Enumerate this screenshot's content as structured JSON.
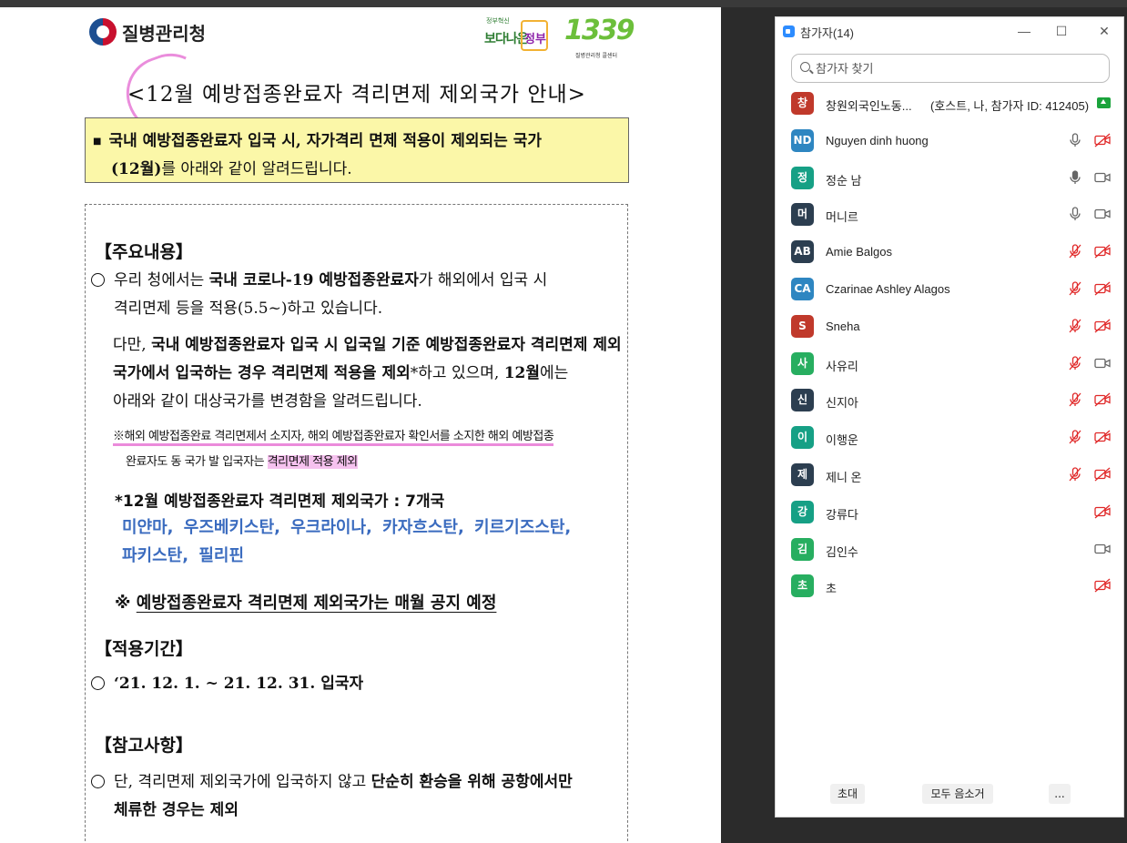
{
  "document": {
    "logo_text": "질병관리청",
    "gov_logo_small": "정부혁신",
    "gov_logo_big": "보다나은",
    "gov_logo_bracket": "정부",
    "hotline": "1339",
    "hotline_sub": "질병관리청 콜센터",
    "title": "<12월 예방접종완료자 격리면제 제외국가 안내>",
    "notice_line1": "국내 예방접종완료자 입국 시, 자가격리 면제 적용이 제외되는 국가",
    "notice_line2_bold": "(12월)",
    "notice_line2_rest": "를 아래와 같이 알려드립니다.",
    "main_heading": "【주요내용】",
    "p1_a": "우리 청에서는 ",
    "p1_b": "국내 코로나-19 예방접종완료자",
    "p1_c": "가 해외에서 입국 시",
    "p1_line2": "격리면제 등을 적용(5.5~)하고 있습니다.",
    "p2_a": "다만, ",
    "p2_b": "국내 예방접종완료자 입국 시 입국일 기준 예방접종완료자 격리면제 제외국가에서 입국하는 경우 격리면제 적용을 제외",
    "p2_c": "*하고 있으며, ",
    "p2_d": "12월",
    "p2_e": "에는",
    "p2_line3": "아래와 같이 대상국가를 변경함을 알려드립니다.",
    "note_a": "※해외 예방접종완료 격리면제서 소지자, 해외 예방접종완료자 확인서를 소지한 해외 예방접종",
    "note_b": "완료자도 동 국가 발 입국자는 ",
    "note_c": "격리면제 적용 제외",
    "excluded_heading": "*12월 예방접종완료자 격리면제 제외국가 : 7개국",
    "countries_line1": "미얀마, 우즈베키스탄, 우크라이나, 카자흐스탄, 키르기즈스탄,",
    "countries_line2": "파키스탄, 필리핀",
    "monthly_mark": "※ ",
    "monthly_notice": "예방접종완료자 격리면제 제외국가는 매월 공지 예정",
    "period_heading": "【적용기간】",
    "period_text": "‘21. 12. 1. ~ 21. 12. 31. 입국자",
    "ref_heading": "【참고사항】",
    "ref_a": "단, 격리면제 제외국가에 입국하지 않고 ",
    "ref_b": "단순히 환승을 위해 공항에서만",
    "ref_line2": "체류한 경우는 제외"
  },
  "panel": {
    "title": "참가자(14)",
    "minimize": "—",
    "maximize": "☐",
    "close": "✕",
    "search_placeholder": "참가자 찾기",
    "participants": [
      {
        "initial": "창",
        "name": "창원외국인노동...",
        "role": "(호스트, 나, 참가자 ID: 412405)",
        "color": "#c0392b",
        "mic": "none",
        "video": "share"
      },
      {
        "initial": "ND",
        "name": "Nguyen dinh huong",
        "role": "",
        "color": "#2e86c1",
        "mic": "on",
        "video": "off"
      },
      {
        "initial": "정",
        "name": "정순 남",
        "role": "",
        "color": "#16a085",
        "mic": "active",
        "video": "on"
      },
      {
        "initial": "머",
        "name": "머니르",
        "role": "",
        "color": "#2c3e50",
        "mic": "on",
        "video": "on"
      },
      {
        "initial": "AB",
        "name": "Amie Balgos",
        "role": "",
        "color": "#2c3e50",
        "mic": "off",
        "video": "off"
      },
      {
        "initial": "CA",
        "name": "Czarinae Ashley Alagos",
        "role": "",
        "color": "#2e86c1",
        "mic": "off",
        "video": "off"
      },
      {
        "initial": "S",
        "name": "Sneha",
        "role": "",
        "color": "#c0392b",
        "mic": "off",
        "video": "off"
      },
      {
        "initial": "사",
        "name": "사유리",
        "role": "",
        "color": "#27ae60",
        "mic": "off",
        "video": "on"
      },
      {
        "initial": "신",
        "name": "신지아",
        "role": "",
        "color": "#2c3e50",
        "mic": "off",
        "video": "off"
      },
      {
        "initial": "이",
        "name": "이행운",
        "role": "",
        "color": "#16a085",
        "mic": "off",
        "video": "off"
      },
      {
        "initial": "제",
        "name": "제니 온",
        "role": "",
        "color": "#2c3e50",
        "mic": "off",
        "video": "off"
      },
      {
        "initial": "강",
        "name": "강류다",
        "role": "",
        "color": "#16a085",
        "mic": "none",
        "video": "off"
      },
      {
        "initial": "김",
        "name": "김인수",
        "role": "",
        "color": "#27ae60",
        "mic": "none",
        "video": "on"
      },
      {
        "initial": "초",
        "name": "초",
        "role": "",
        "color": "#27ae60",
        "mic": "none",
        "video": "off"
      }
    ],
    "invite_label": "초대",
    "mute_all_label": "모두 음소거",
    "more_label": "..."
  },
  "colors": {
    "mic_off": "#e02828",
    "icon_gray": "#666666",
    "share_green": "#1aa33b",
    "highlight_yellow": "#fbf7a8",
    "country_blue": "#3a6bbf"
  }
}
